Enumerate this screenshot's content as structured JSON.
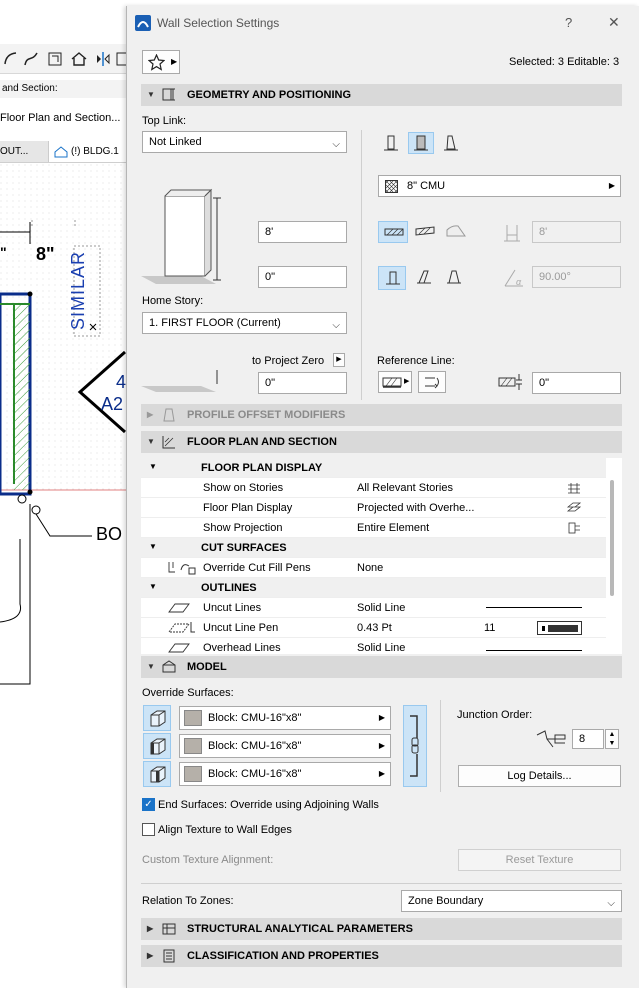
{
  "background": {
    "toolbar_row_text": "and Section:",
    "tab_row_text": "Floor Plan and Section...",
    "doc_tab_left": "OUT...",
    "doc_tab_right": "(!) BLDG.1",
    "dim_text": "8\"",
    "similar_text": "SIMILAR",
    "marker_top": "4",
    "marker_bottom": "A2",
    "bo_text": "BO"
  },
  "dialog": {
    "title": "Wall Selection Settings",
    "help": "?",
    "close": "✕",
    "selected_status": "Selected: 3 Editable: 3",
    "sections": {
      "geometry": "GEOMETRY AND POSITIONING",
      "profile": "PROFILE OFFSET MODIFIERS",
      "floorplan": "FLOOR PLAN AND SECTION",
      "model": "MODEL",
      "structural": "STRUCTURAL ANALYTICAL PARAMETERS",
      "classification": "CLASSIFICATION AND PROPERTIES"
    },
    "geometry": {
      "top_link_label": "Top Link:",
      "top_link_value": "Not Linked",
      "height_value": "8'",
      "bottom_offset_value": "0\"",
      "home_story_label": "Home Story:",
      "home_story_value": "1. FIRST FLOOR (Current)",
      "to_project_zero_label": "to Project Zero",
      "project_zero_value": "0\"",
      "composite_value": "8\" CMU",
      "thickness_value": "8'",
      "angle_value": "90.00°",
      "reference_line_label": "Reference Line:",
      "reference_offset_value": "0\""
    },
    "floorplan": {
      "rows": [
        {
          "type": "group",
          "name": "FLOOR PLAN DISPLAY"
        },
        {
          "type": "item",
          "name": "Show on Stories",
          "value": "All Relevant Stories"
        },
        {
          "type": "item",
          "name": "Floor Plan Display",
          "value": "Projected with Overhe..."
        },
        {
          "type": "item",
          "name": "Show Projection",
          "value": "Entire Element"
        },
        {
          "type": "group",
          "name": "CUT SURFACES"
        },
        {
          "type": "item",
          "name": "Override Cut Fill Pens",
          "value": "None"
        },
        {
          "type": "group",
          "name": "OUTLINES"
        },
        {
          "type": "item",
          "name": "Uncut Lines",
          "value": "Solid Line"
        },
        {
          "type": "item",
          "name": "Uncut Line Pen",
          "value": "0.43 Pt",
          "extra": "11"
        },
        {
          "type": "item",
          "name": "Overhead Lines",
          "value": "Solid Line"
        }
      ]
    },
    "model": {
      "override_surfaces_label": "Override Surfaces:",
      "surfaces": [
        "Block: CMU-16\"x8\"",
        "Block: CMU-16\"x8\"",
        "Block: CMU-16\"x8\""
      ],
      "junction_order_label": "Junction Order:",
      "junction_order_value": "8",
      "log_details_button": "Log Details...",
      "end_surfaces_label": "End Surfaces: Override using Adjoining Walls",
      "end_surfaces_checked": true,
      "align_texture_label": "Align Texture to Wall Edges",
      "align_texture_checked": false,
      "custom_texture_label": "Custom Texture Alignment:",
      "reset_texture_button": "Reset Texture",
      "relation_label": "Relation To Zones:",
      "relation_value": "Zone Boundary"
    },
    "colors": {
      "accent": "#1a73c8",
      "section_bg": "#d9d9d9",
      "active_button": "#cce4f7"
    }
  }
}
